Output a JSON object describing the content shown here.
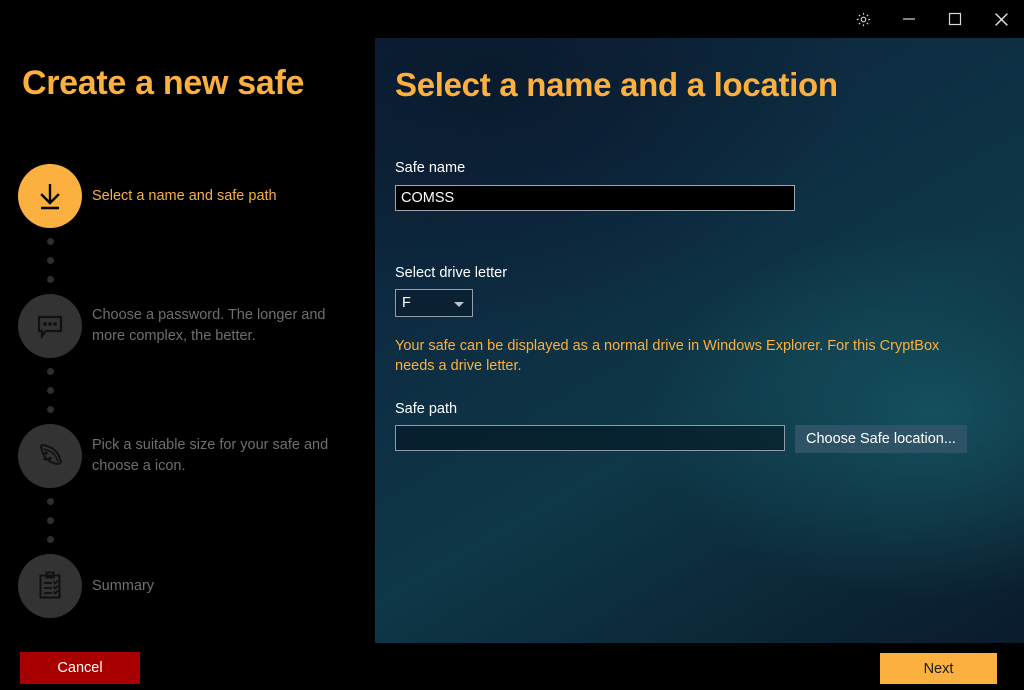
{
  "window": {
    "controls": [
      {
        "name": "settings-button",
        "icon": "gear-icon",
        "label": "Settings"
      },
      {
        "name": "minimize-button",
        "icon": "minimize-icon",
        "label": "Minimize"
      },
      {
        "name": "maximize-button",
        "icon": "maximize-icon",
        "label": "Maximize"
      },
      {
        "name": "close-button",
        "icon": "close-icon",
        "label": "Close"
      }
    ]
  },
  "sidebar": {
    "title": "Create a new safe",
    "cancel_label": "Cancel",
    "steps": [
      {
        "label": "Select a name and safe path",
        "icon": "download-arrow-icon",
        "state": "active"
      },
      {
        "label": "Choose a password. The longer and more complex, the better.",
        "icon": "chat-bubble-icon",
        "state": "inactive"
      },
      {
        "label": "Pick a suitable size for your safe and choose a icon.",
        "icon": "pizza-slice-icon",
        "state": "inactive"
      },
      {
        "label": "Summary",
        "icon": "clipboard-checklist-icon",
        "state": "inactive"
      }
    ]
  },
  "main": {
    "title": "Select a name and a location",
    "safe_name": {
      "label": "Safe name",
      "value": "COMSS",
      "placeholder": ""
    },
    "drive_letter": {
      "label": "Select drive letter",
      "value": "F",
      "options": [
        "F"
      ]
    },
    "drive_hint": "Your safe can be displayed as a normal drive in Windows Explorer. For this CryptBox needs a drive letter.",
    "safe_path": {
      "label": "Safe path",
      "value": "",
      "placeholder": "",
      "button_label": "Choose Safe location..."
    }
  },
  "footer": {
    "next_label": "Next"
  },
  "colors": {
    "accent": "#fbb040",
    "cancel": "#a80000",
    "panel_dark": "#0d2138",
    "panel_teal": "#0e3747",
    "inactive_step": "#333333"
  }
}
